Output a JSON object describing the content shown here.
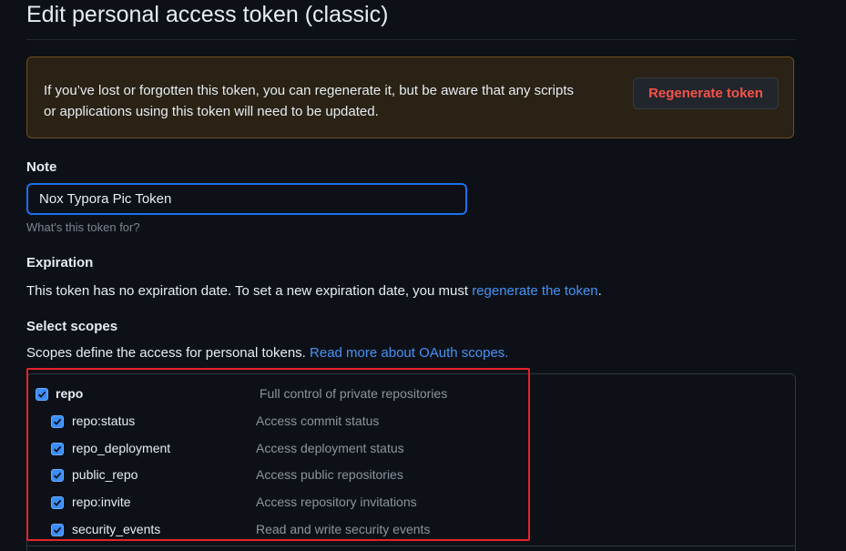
{
  "page": {
    "title": "Edit personal access token (classic)"
  },
  "flash": {
    "message_line1": "If you’ve lost or forgotten this token, you can regenerate it, but be aware that any scripts",
    "message_line2": "or applications using this token will need to be updated.",
    "regenerate_label": "Regenerate token"
  },
  "note": {
    "label": "Note",
    "value": "Nox Typora Pic Token",
    "hint": "What's this token for?"
  },
  "expiration": {
    "label": "Expiration",
    "text": "This token has no expiration date. To set a new expiration date, you must ",
    "link": "regenerate the token",
    "suffix": "."
  },
  "scopes": {
    "label": "Select scopes",
    "text": "Scopes define the access for personal tokens. ",
    "link": "Read more about OAuth scopes.",
    "items": [
      {
        "name": "repo",
        "description": "Full control of private repositories",
        "checked": true
      },
      {
        "name": "repo:status",
        "description": "Access commit status",
        "checked": true
      },
      {
        "name": "repo_deployment",
        "description": "Access deployment status",
        "checked": true
      },
      {
        "name": "public_repo",
        "description": "Access public repositories",
        "checked": true
      },
      {
        "name": "repo:invite",
        "description": "Access repository invitations",
        "checked": true
      },
      {
        "name": "security_events",
        "description": "Read and write security events",
        "checked": true
      }
    ]
  },
  "colors": {
    "background": "#0d1117",
    "link": "#4493f8",
    "danger": "#f85149",
    "warning_border": "#6a4e1f",
    "checkbox": "#3b8ef8",
    "highlight": "#e5232a"
  },
  "icons": {
    "checkbox": "check-icon"
  }
}
